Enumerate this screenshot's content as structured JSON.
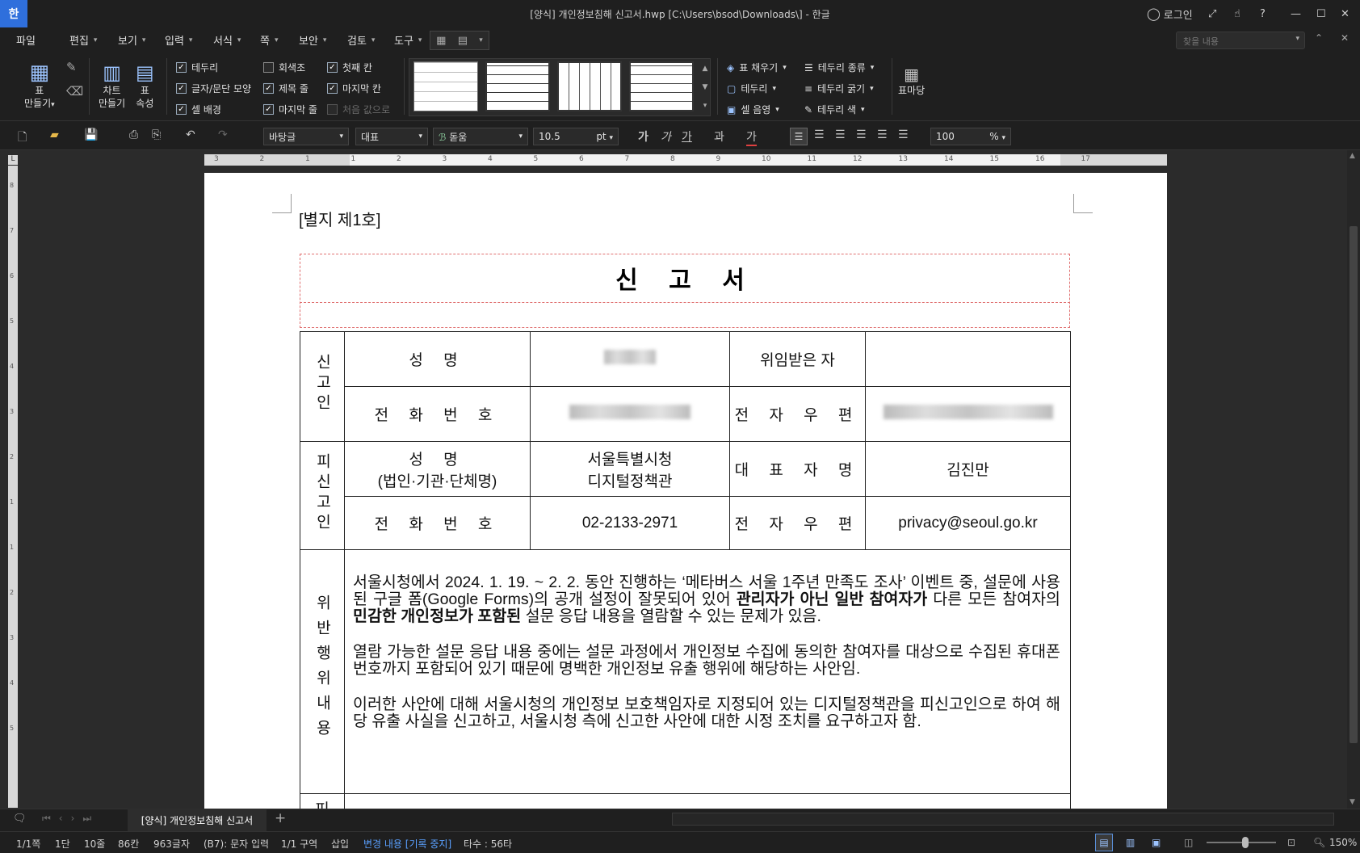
{
  "window": {
    "logo": "한",
    "title": "[양식] 개인정보침해 신고서.hwp [C:\\Users\\bsod\\Downloads\\] - 한글",
    "login": "로그인"
  },
  "menu": {
    "items": [
      "파일",
      "편집",
      "보기",
      "입력",
      "서식",
      "쪽",
      "보안",
      "검토",
      "도구"
    ],
    "search_placeholder": "찾을 내용"
  },
  "ribbon": {
    "make_table": [
      "표",
      "만들기"
    ],
    "make_chart": [
      "차트",
      "만들기"
    ],
    "table_props": [
      "표",
      "속성"
    ],
    "checks_col1": [
      {
        "label": "테두리",
        "checked": true
      },
      {
        "label": "글자/문단 모양",
        "checked": true
      },
      {
        "label": "셀 배경",
        "checked": true
      }
    ],
    "checks_col2": [
      {
        "label": "회색조",
        "checked": false
      },
      {
        "label": "제목 줄",
        "checked": true
      },
      {
        "label": "마지막 줄",
        "checked": true
      }
    ],
    "checks_col3": [
      {
        "label": "첫째 칸",
        "checked": true
      },
      {
        "label": "마지막 칸",
        "checked": true
      },
      {
        "label": "처음 값으로",
        "checked": false,
        "disabled": true
      }
    ],
    "fill_menu": [
      "표 채우기",
      "테두리",
      "셀 음영"
    ],
    "border_menu": [
      "테두리 종류",
      "테두리 굵기",
      "테두리 색"
    ],
    "table_style": "표마당"
  },
  "toolbar": {
    "font_style": "바탕글",
    "para_style": "대표",
    "font_name": "돋움",
    "font_size": "10.5",
    "font_unit": "pt",
    "zoom": "100",
    "zoom_unit": "%",
    "char_fmt": [
      "가",
      "가",
      "가",
      "과",
      "가"
    ]
  },
  "document": {
    "attach_label": "[별지 제1호]",
    "title": "신 고 서",
    "reporter_label": "신고인",
    "respondent_label": "피신고인",
    "violation_label": "위반행위내용",
    "name_label": "성    명",
    "name_sub": "(법인·기관·단체명)",
    "phone_label": "전 화 번 호",
    "delegate_label": "위임받은 자",
    "email_label": "전 자 우 편",
    "rep_label": "대 표 자 명",
    "respondent_name": [
      "서울특별시청",
      "디지털정책관"
    ],
    "respondent_rep": "김진만",
    "respondent_phone": "02-2133-2971",
    "respondent_email": "privacy@seoul.go.kr",
    "next_row_char": "피",
    "paragraphs": [
      {
        "before": "서울시청에서 2024. 1. 19. ~ 2. 2. 동안 진행하는 ‘메타버스 서울 1주년 만족도 조사’ 이벤트 중, 설문에 사용된 구글 폼(Google Forms)의 공개 설정이 잘못되어 있어 ",
        "b1": "관리자가 아닌 일반 참여자가",
        "mid": " 다른 모든 참여자의 ",
        "b2": "민감한 개인정보가 포함된",
        "after": " 설문 응답 내용을 열람할 수 있는 문제가 있음."
      },
      {
        "text": "열람 가능한 설문 응답 내용 중에는 설문 과정에서 개인정보 수집에 동의한 참여자를 대상으로 수집된 휴대폰 번호까지 포함되어 있기 때문에 명백한 개인정보 유출 행위에 해당하는 사안임."
      },
      {
        "text": "이러한 사안에 대해 서울시청의 개인정보 보호책임자로 지정되어 있는 디지털정책관을 피신고인으로 하여 해당 유출 사실을 신고하고, 서울시청 측에 신고한 사안에 대한 시정 조치를 요구하고자 함."
      }
    ]
  },
  "tabs": {
    "doc_tab": "[양식] 개인정보침해 신고서",
    "add": "+"
  },
  "status": {
    "page": "1/1쪽",
    "column": "1단",
    "line": "10줄",
    "col": "86칸",
    "chars": "963글자",
    "mode": "(B7): 문자 입력",
    "section": "1/1 구역",
    "insert": "삽입",
    "track": "변경 내용 [기록 중지]",
    "keystrokes": "타수 : 56타",
    "zoom": "150%"
  },
  "ruler_h": [
    "3",
    "2",
    "1",
    "1",
    "2",
    "3",
    "4",
    "5",
    "6",
    "7",
    "8",
    "9",
    "10",
    "11",
    "12",
    "13",
    "14",
    "15",
    "16",
    "17"
  ],
  "ruler_v": [
    "8",
    "7",
    "6",
    "5",
    "4",
    "3",
    "2",
    "1",
    "1",
    "2",
    "3",
    "4",
    "5"
  ]
}
